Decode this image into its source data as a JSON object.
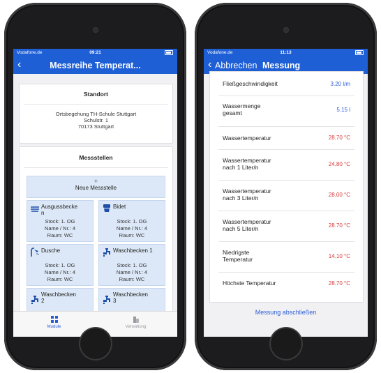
{
  "left": {
    "status": {
      "carrier": "Vodafone.de",
      "time": "09:21"
    },
    "nav": {
      "title": "Messreihe Temperat..."
    },
    "standort": {
      "title": "Standort",
      "line1": "Ortsbegehung TH-Schule Stuttgart",
      "line2": "Schulstr. 1",
      "line3": "70173 Stuttgart"
    },
    "messstellen": {
      "title": "Messstellen",
      "new_plus": "+",
      "new_label": "Neue Messstelle",
      "tiles": [
        {
          "name": "Ausgussbecke\nn",
          "info1": "Stock: 1. OG",
          "info2": "Name / Nr.: 4",
          "info3": "Raum: WC",
          "icon": "sink-basin-icon"
        },
        {
          "name": "Bidet",
          "info1": "Stock: 1. OG",
          "info2": "Name / Nr.: 4",
          "info3": "Raum: WC",
          "icon": "bidet-icon"
        },
        {
          "name": "Dusche",
          "info1": "Stock: 1. OG",
          "info2": "Name / Nr.: 4",
          "info3": "Raum: WC",
          "icon": "shower-icon"
        },
        {
          "name": "Waschbecken 1",
          "info1": "Stock: 1. OG",
          "info2": "Name / Nr.: 4",
          "info3": "Raum: WC",
          "icon": "faucet-icon"
        },
        {
          "name": "Waschbecken\n2",
          "info1": "",
          "info2": "",
          "info3": "",
          "icon": "faucet-icon"
        },
        {
          "name": "Waschbecken\n3",
          "info1": "",
          "info2": "",
          "info3": "",
          "icon": "faucet-icon"
        }
      ]
    },
    "tabs": [
      {
        "label": "Module",
        "icon": "modules-grid-icon",
        "color": "#2a5bd7"
      },
      {
        "label": "Verwaltung",
        "icon": "building-icon",
        "color": "#9a9aa0"
      }
    ]
  },
  "right": {
    "status": {
      "carrier": "Vodafone.de",
      "time": "11:13"
    },
    "nav": {
      "back_label": "Abbrechen",
      "title": "Messung"
    },
    "rows": [
      {
        "label": "Fließgeschwindigkeit",
        "value": "3.20 l/m",
        "color": "blue"
      },
      {
        "label": "Wassermenge\ngesamt",
        "value": "5.15 l",
        "color": "blue"
      },
      {
        "label": "Wassertemperatur",
        "value": "28.70 °C",
        "color": "red"
      },
      {
        "label": "Wassertemperatur\nnach 1 Liter/n",
        "value": "24.80 °C",
        "color": "red"
      },
      {
        "label": "Wassertemperatur\nnach 3 Liter/n",
        "value": "28.00 °C",
        "color": "red"
      },
      {
        "label": "Wassertemperatur\nnach 5 Liter/n",
        "value": "28.70 °C",
        "color": "red"
      },
      {
        "label": "Niedrigste\nTemperatur",
        "value": "14.10 °C",
        "color": "red"
      },
      {
        "label": "Höchste Temperatur",
        "value": "28.70 °C",
        "color": "red"
      }
    ],
    "finish_label": "Messung abschließen"
  },
  "colors": {
    "brand": "#1f5fd6",
    "tile_bg": "#dce8f7",
    "value_blue": "#2a5bd7",
    "value_red": "#d73a3a"
  }
}
